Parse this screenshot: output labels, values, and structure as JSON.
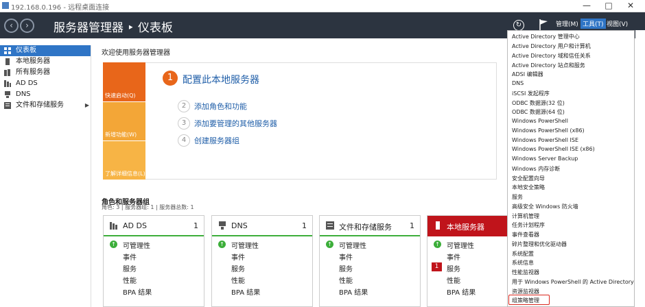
{
  "window": {
    "title": "192.168.0.196 - 远程桌面连接",
    "minimize": "—",
    "maximize": "□",
    "close": "✕"
  },
  "header": {
    "title": "服务器管理器 ‣ 仪表板",
    "manage": "管理(M)",
    "tools": "工具(T)",
    "view": "视图(V)",
    "back_icon": "back-arrow-icon",
    "forward_icon": "forward-arrow-icon"
  },
  "sidebar": {
    "items": [
      {
        "label": "仪表板",
        "icon": "dashboard-icon"
      },
      {
        "label": "本地服务器",
        "icon": "server-icon"
      },
      {
        "label": "所有服务器",
        "icon": "servers-icon"
      },
      {
        "label": "AD DS",
        "icon": "ad-ds-icon"
      },
      {
        "label": "DNS",
        "icon": "dns-icon"
      },
      {
        "label": "文件和存储服务",
        "icon": "storage-icon"
      }
    ]
  },
  "main": {
    "welcome": "欢迎使用服务器管理器",
    "tiles": {
      "quick_start": "快速启动(Q)",
      "whats_new": "新增功能(W)",
      "learn_more": "了解详细信息(L)"
    },
    "steps": [
      {
        "num": "1",
        "label": "配置此本地服务器"
      },
      {
        "num": "2",
        "label": "添加角色和功能"
      },
      {
        "num": "3",
        "label": "添加要管理的其他服务器"
      },
      {
        "num": "4",
        "label": "创建服务器组"
      }
    ],
    "roles_title": "角色和服务器组",
    "roles_sub": "角色: 3 | 服务器组: 1 | 服务器总数: 1",
    "cards": [
      {
        "title": "AD DS",
        "count": "1",
        "rows": [
          "可管理性",
          "事件",
          "服务",
          "性能",
          "BPA 结果"
        ]
      },
      {
        "title": "DNS",
        "count": "1",
        "rows": [
          "可管理性",
          "事件",
          "服务",
          "性能",
          "BPA 结果"
        ]
      },
      {
        "title": "文件和存储服务",
        "count": "1",
        "rows": [
          "可管理性",
          "事件",
          "服务",
          "性能",
          "BPA 结果"
        ]
      },
      {
        "title": "本地服务器",
        "count": "",
        "rows": [
          "可管理性",
          "事件",
          "服务",
          "性能",
          "BPA 结果"
        ],
        "service_badge": "1"
      }
    ]
  },
  "tools_menu": {
    "items": [
      "Active Directory 管理中心",
      "Active Directory 用户和计算机",
      "Active Directory 域和信任关系",
      "Active Directory 站点和服务",
      "ADSI 编辑器",
      "DNS",
      "iSCSI 发起程序",
      "ODBC 数据源(32 位)",
      "ODBC 数据源(64 位)",
      "Windows PowerShell",
      "Windows PowerShell (x86)",
      "Windows PowerShell ISE",
      "Windows PowerShell ISE (x86)",
      "Windows Server Backup",
      "Windows 内存诊断",
      "安全配置向导",
      "本地安全策略",
      "服务",
      "高级安全 Windows 防火墙",
      "计算机管理",
      "任务计划程序",
      "事件查看器",
      "碎片整理和优化驱动器",
      "系统配置",
      "系统信息",
      "性能监视器",
      "用于 Windows PowerShell 的 Active Directory 模块",
      "资源监视器",
      "组策略管理"
    ]
  },
  "colors": {
    "header_bg": "#2c3440",
    "accent": "#2f75c6",
    "quick_start": "#e8661a",
    "whats_new": "#f3a637",
    "learn_more": "#f7b445",
    "ok_green": "#3cae3a",
    "alert_red": "#c0141b"
  }
}
